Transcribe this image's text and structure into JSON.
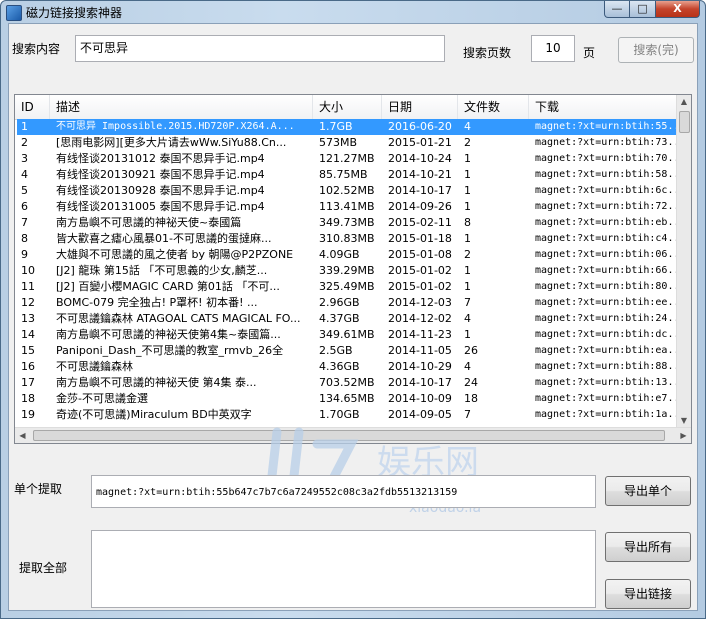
{
  "window": {
    "title": "磁力链接搜索神器",
    "min_glyph": "—",
    "max_glyph": "□",
    "close_glyph": "X"
  },
  "search": {
    "label": "搜索内容",
    "value": "不可思异",
    "pages_label": "搜索页数",
    "pages_value": "10",
    "pages_unit": "页",
    "search_button": "搜索(完)"
  },
  "table": {
    "columns": [
      "ID",
      "描述",
      "大小",
      "日期",
      "文件数",
      "下载"
    ],
    "rows": [
      [
        "1",
        "不可思异 Impossible.2015.HD720P.X264.A...",
        "1.7GB",
        "2016-06-20",
        "4",
        "magnet:?xt=urn:btih:55..."
      ],
      [
        "2",
        "[思雨电影网][更多大片请去wWw.SiYu88.Cn...",
        "573MB",
        "2015-01-21",
        "2",
        "magnet:?xt=urn:btih:73..."
      ],
      [
        "3",
        "有线怪谈20131012 泰国不思异手记.mp4",
        "121.27MB",
        "2014-10-24",
        "1",
        "magnet:?xt=urn:btih:70..."
      ],
      [
        "4",
        "有线怪谈20130921 泰国不思异手记.mp4",
        "85.75MB",
        "2014-10-21",
        "1",
        "magnet:?xt=urn:btih:58..."
      ],
      [
        "5",
        "有线怪谈20130928 泰国不思异手记.mp4",
        "102.52MB",
        "2014-10-17",
        "1",
        "magnet:?xt=urn:btih:6c..."
      ],
      [
        "6",
        "有线怪谈20131005 泰国不思异手记.mp4",
        "113.41MB",
        "2014-09-26",
        "1",
        "magnet:?xt=urn:btih:72..."
      ],
      [
        "7",
        "南方島嶼不可思議的神祕天使~泰國篇",
        "349.73MB",
        "2015-02-11",
        "8",
        "magnet:?xt=urn:btih:eb..."
      ],
      [
        "8",
        "皆大歡喜之瘧心風暴01-不可思議的蛋撻麻...",
        "310.83MB",
        "2015-01-18",
        "1",
        "magnet:?xt=urn:btih:c4..."
      ],
      [
        "9",
        "大雄與不可思議的風之使者 by 朝陽@P2PZONE",
        "4.09GB",
        "2015-01-08",
        "2",
        "magnet:?xt=urn:btih:06..."
      ],
      [
        "10",
        "[J2] 龍珠 第15話 「不可思義的少女,麟芝...",
        "339.29MB",
        "2015-01-02",
        "1",
        "magnet:?xt=urn:btih:66..."
      ],
      [
        "11",
        "[J2] 百變小櫻MAGIC CARD 第01話 「不可...",
        "325.49MB",
        "2015-01-02",
        "1",
        "magnet:?xt=urn:btih:80..."
      ],
      [
        "12",
        "BOMC-079 完全独占! P罩杯! 初本番! ...",
        "2.96GB",
        "2014-12-03",
        "7",
        "magnet:?xt=urn:btih:ee..."
      ],
      [
        "13",
        "不可思議鑰森林 ATAGOAL CATS MAGICAL FO...",
        "4.37GB",
        "2014-12-02",
        "4",
        "magnet:?xt=urn:btih:24..."
      ],
      [
        "14",
        "南方島嶼不可思議的神祕天使第4集~泰國篇...",
        "349.61MB",
        "2014-11-23",
        "1",
        "magnet:?xt=urn:btih:dc..."
      ],
      [
        "15",
        "Paniponi_Dash_不可思議的教室_rmvb_26全",
        "2.5GB",
        "2014-11-05",
        "26",
        "magnet:?xt=urn:btih:ea..."
      ],
      [
        "16",
        "不可思議鑰森林",
        "4.36GB",
        "2014-10-29",
        "4",
        "magnet:?xt=urn:btih:88..."
      ],
      [
        "17",
        "南方島嶼不可思議的神祕天使 第4集 泰...",
        "703.52MB",
        "2014-10-17",
        "24",
        "magnet:?xt=urn:btih:13..."
      ],
      [
        "18",
        "金莎-不可思議金選",
        "134.65MB",
        "2014-10-09",
        "18",
        "magnet:?xt=urn:btih:e7..."
      ],
      [
        "19",
        "奇迹(不可思議)Miraculum BD中英双字",
        "1.70GB",
        "2014-09-05",
        "7",
        "magnet:?xt=urn:btih:1a..."
      ]
    ]
  },
  "single": {
    "label": "单个提取",
    "value": "magnet:?xt=urn:btih:55b647c7b7c6a7249552c08c3a2fdb5513213159",
    "export_button": "导出单个"
  },
  "all": {
    "label": "提取全部",
    "value": "",
    "export_all_button": "导出所有",
    "export_links_button": "导出链接"
  },
  "watermark": {
    "text": "娱乐网",
    "url": "xiaodao.la"
  },
  "colors": {
    "selection": "#3399ff",
    "window_frame": "#b9cfe4",
    "client": "#f0f0f0"
  }
}
